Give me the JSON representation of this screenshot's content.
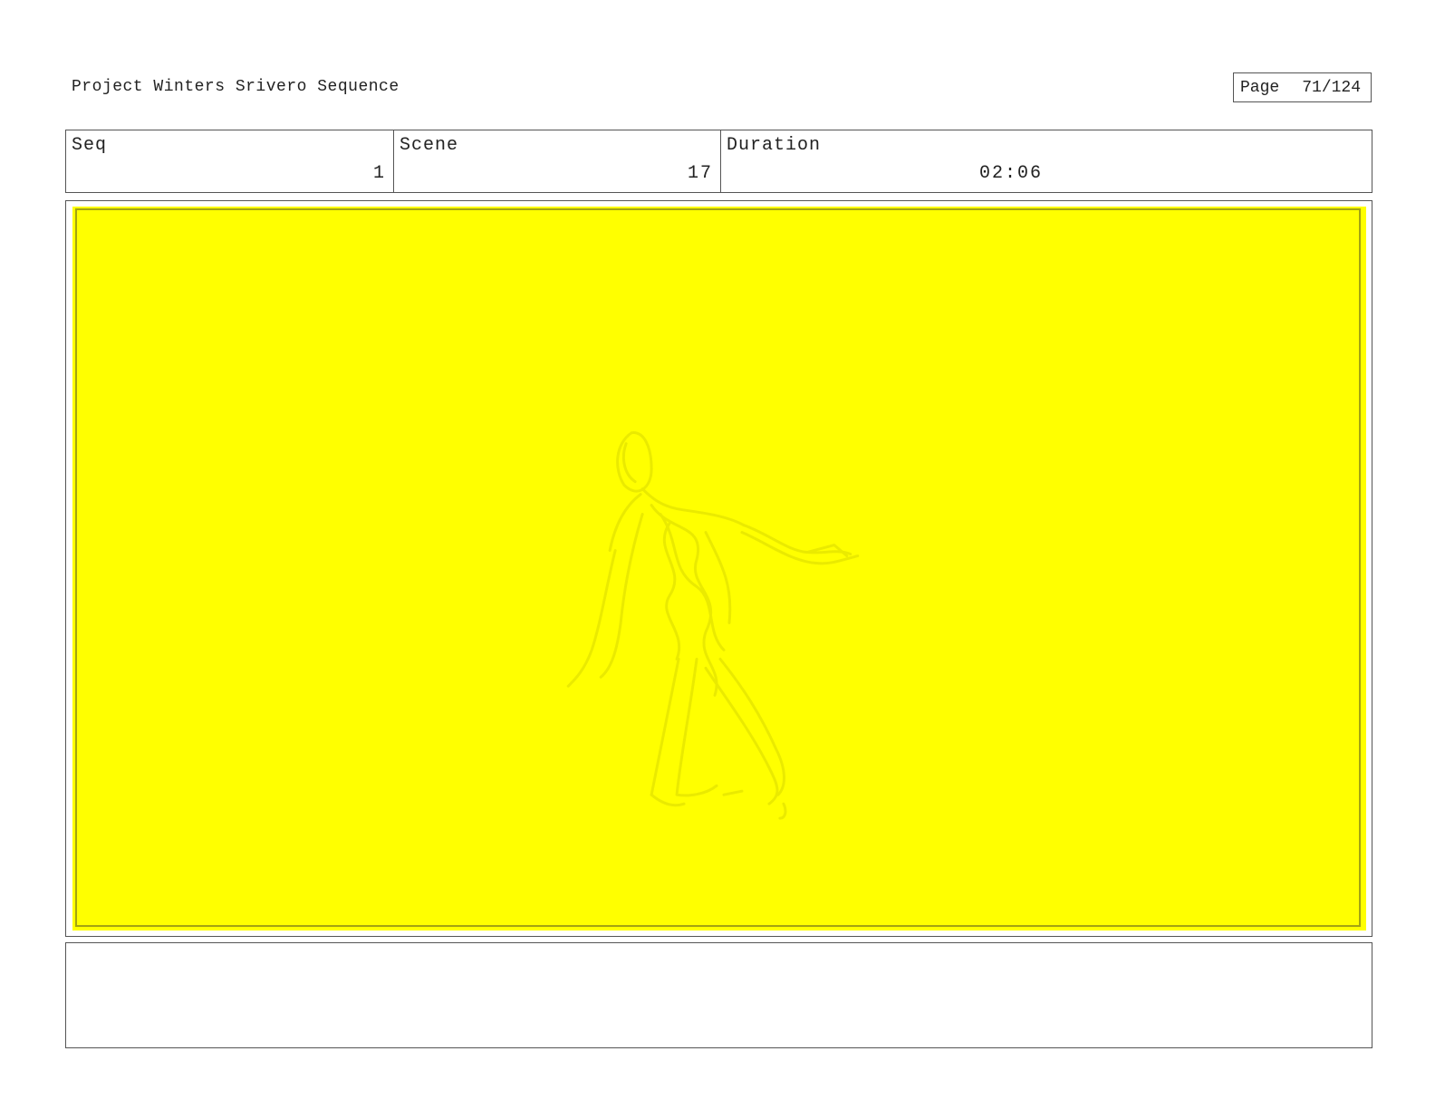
{
  "header": {
    "project_title": "Project Winters Srivero Sequence",
    "page_label": "Page",
    "page_number": "71/124"
  },
  "info": {
    "seq_label": "Seq",
    "seq_value": "1",
    "scene_label": "Scene",
    "scene_value": "17",
    "duration_label": "Duration",
    "duration_value": "02:06"
  },
  "panel": {
    "background_color": "#ffff00",
    "border_color": "#a3a312",
    "sketch_color": "#e8e800"
  },
  "notes": {
    "text": ""
  }
}
